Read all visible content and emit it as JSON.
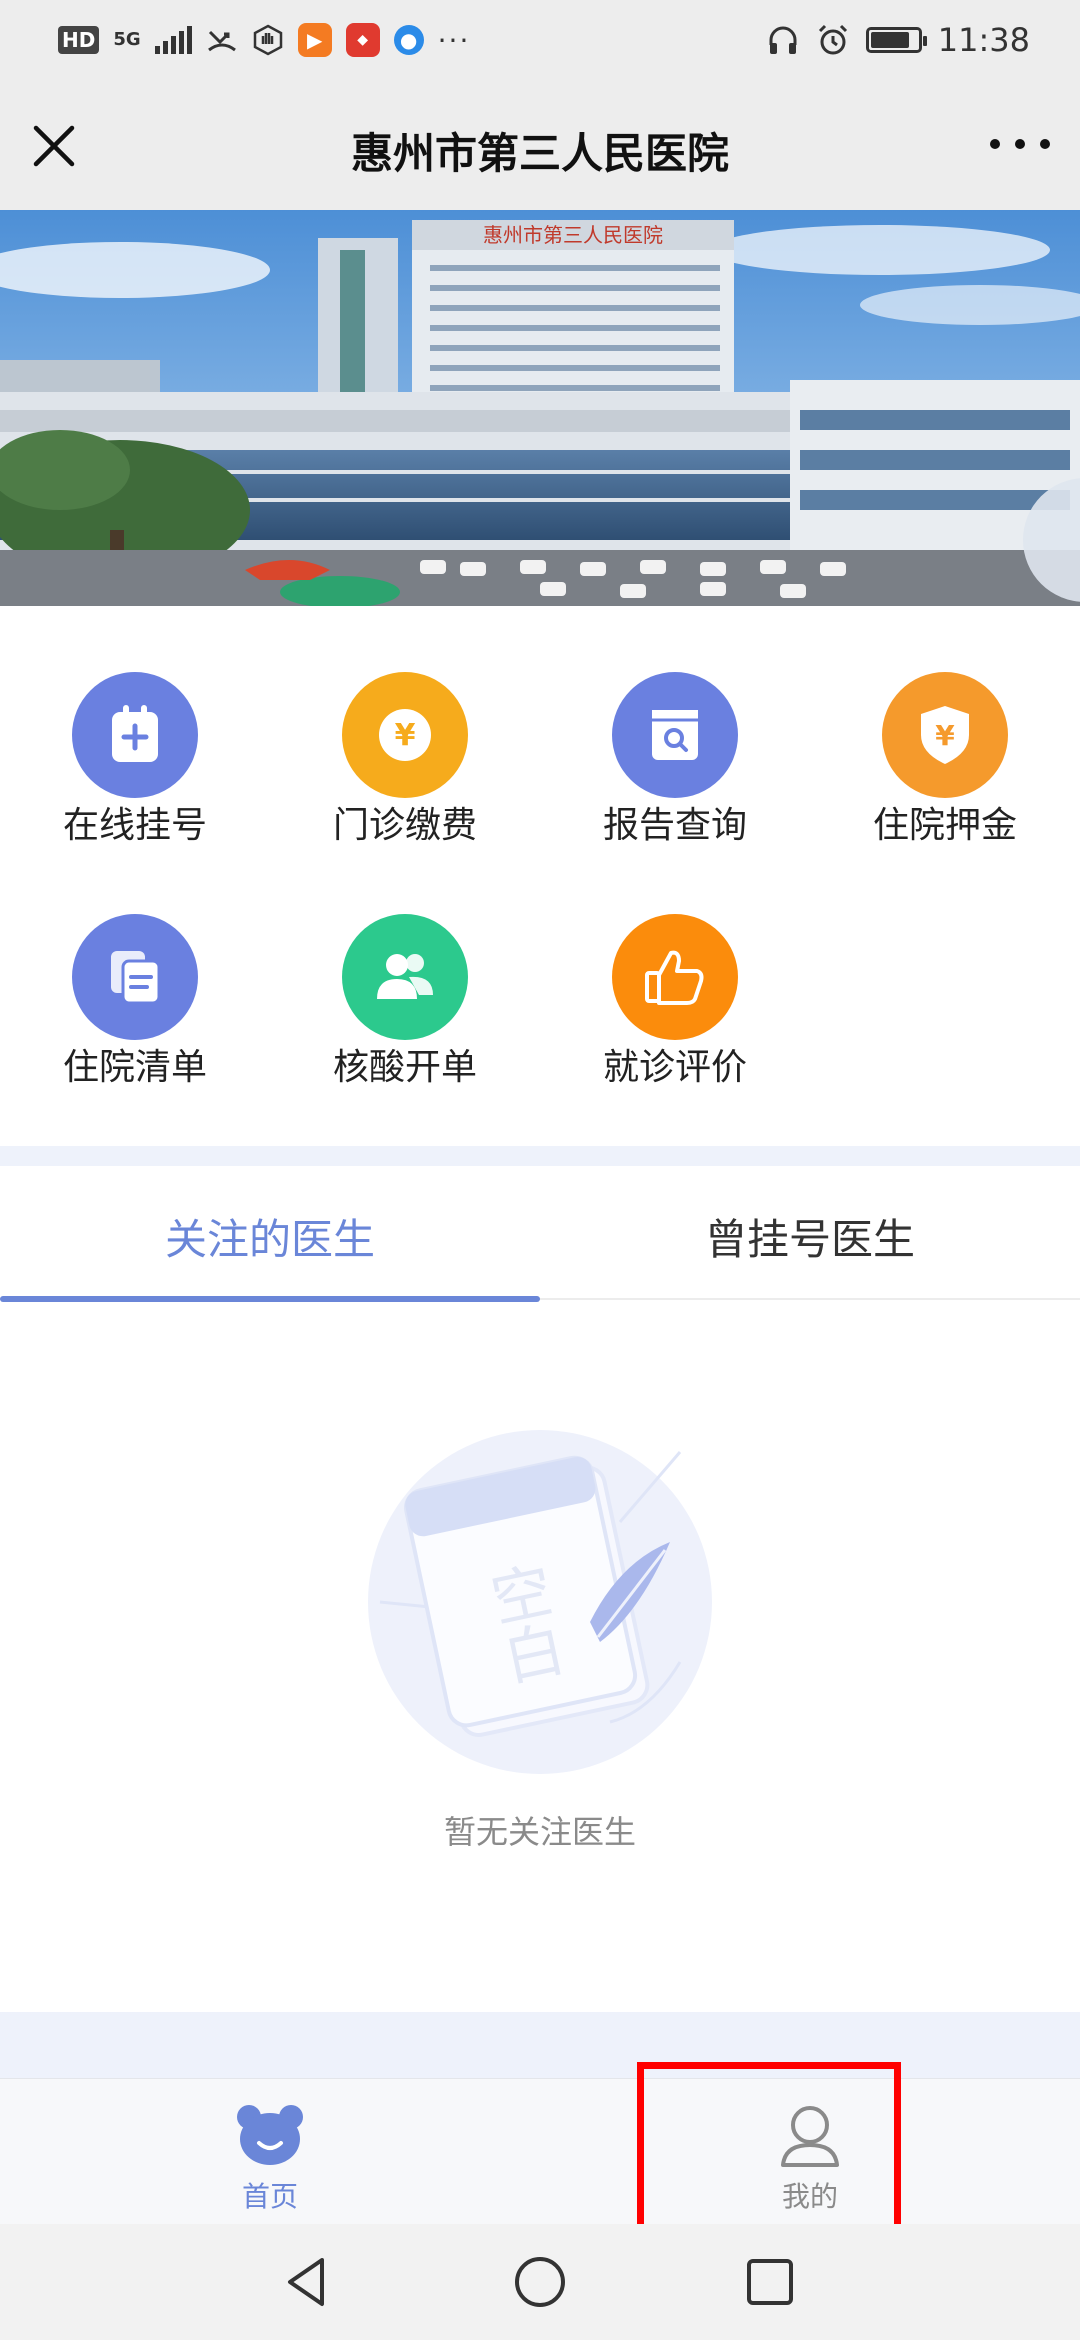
{
  "status_bar": {
    "left_badges": [
      "HD",
      "5G"
    ],
    "time": "11:38",
    "overflow": "···",
    "battery_level": 0.85
  },
  "title_bar": {
    "title": "惠州市第三人民医院"
  },
  "banner": {
    "building_sign": "惠州市第三人民医院"
  },
  "menu": {
    "items": [
      {
        "label": "在线挂号",
        "icon": "registration-icon",
        "color": "#6a80e0"
      },
      {
        "label": "门诊缴费",
        "icon": "yuan-coin-icon",
        "color": "#f6ab1c"
      },
      {
        "label": "报告查询",
        "icon": "report-search-icon",
        "color": "#6a80e0"
      },
      {
        "label": "住院押金",
        "icon": "yuan-shield-icon",
        "color": "#f59a2c"
      },
      {
        "label": "住院清单",
        "icon": "document-list-icon",
        "color": "#6a80e0"
      },
      {
        "label": "核酸开单",
        "icon": "people-icon",
        "color": "#2cc98d"
      },
      {
        "label": "就诊评价",
        "icon": "thumbs-up-icon",
        "color": "#fb8c0c"
      }
    ]
  },
  "tabs": {
    "followed": "关注的医生",
    "registered": "曾挂号医生"
  },
  "empty_state": {
    "illustration_text": "空白",
    "message": "暂无关注医生"
  },
  "bottom_nav": {
    "home": "首页",
    "mine": "我的"
  },
  "colors": {
    "accent": "#6a86d8",
    "highlight": "#ff0000"
  }
}
